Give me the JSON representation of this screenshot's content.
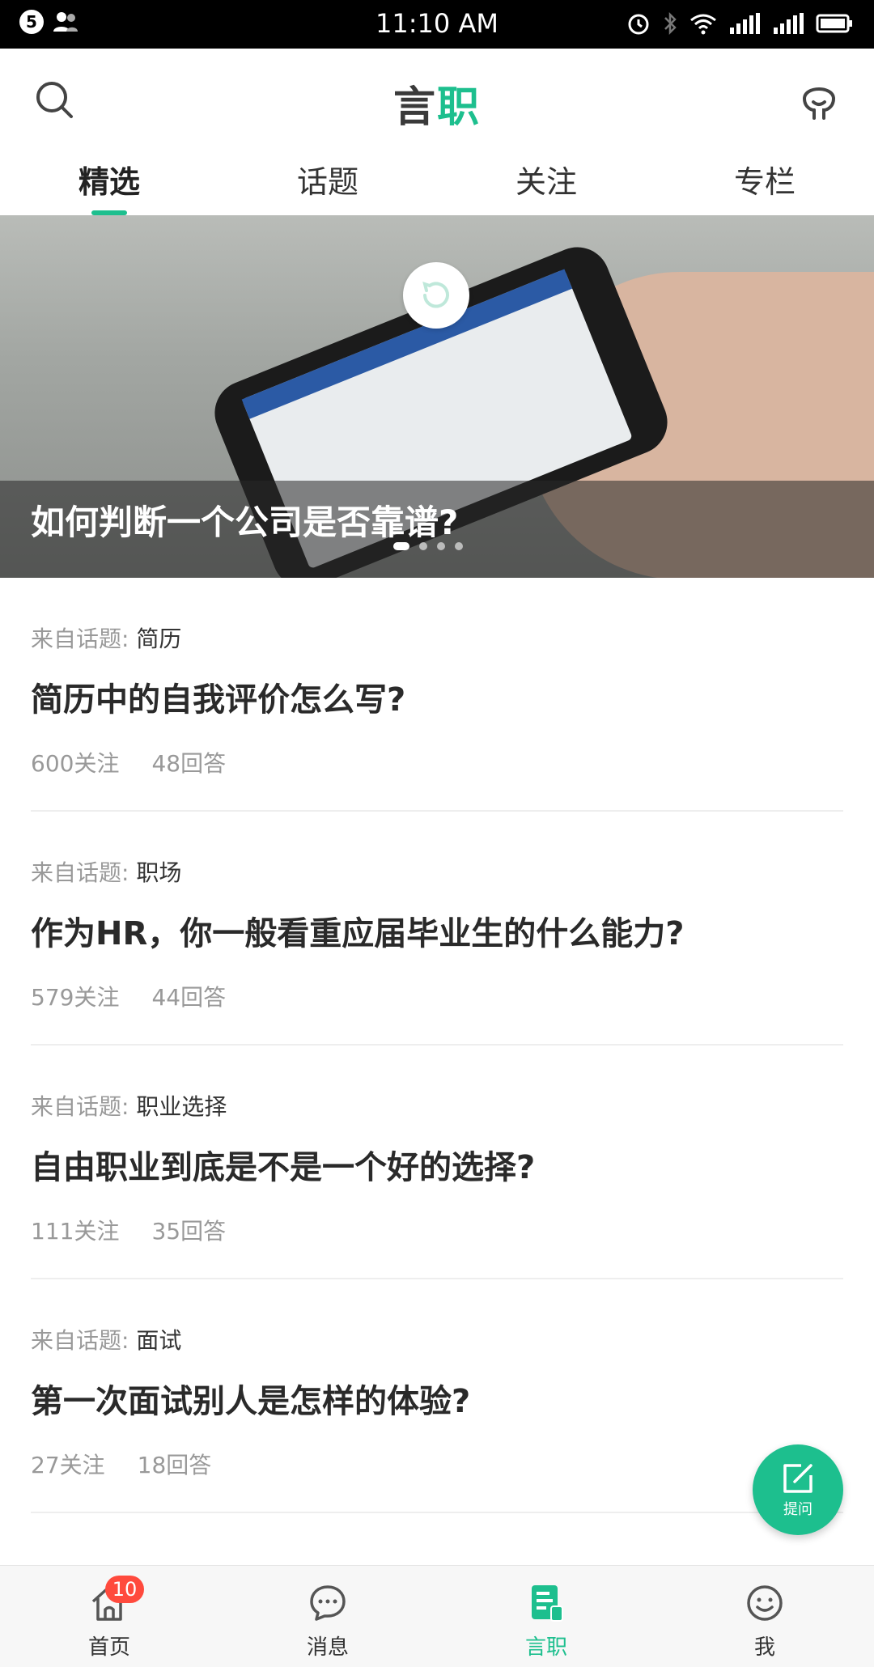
{
  "status_bar": {
    "notification_count": "5",
    "time": "11:10 AM"
  },
  "header": {
    "brand_part1": "言",
    "brand_part2": "职",
    "search_icon": "search-icon",
    "profile_icon": "robot-face-icon"
  },
  "tabs": [
    {
      "label": "精选",
      "active": true
    },
    {
      "label": "话题",
      "active": false
    },
    {
      "label": "关注",
      "active": false
    },
    {
      "label": "专栏",
      "active": false
    }
  ],
  "banner": {
    "title": "如何判断一个公司是否靠谱?",
    "page_count": 4,
    "active_page": 1
  },
  "feed": {
    "from_prefix": "来自话题:",
    "items": [
      {
        "topic": "简历",
        "question": "简历中的自我评价怎么写?",
        "follows": "600关注",
        "answers": "48回答"
      },
      {
        "topic": "职场",
        "question": "作为HR，你一般看重应届毕业生的什么能力?",
        "follows": "579关注",
        "answers": "44回答"
      },
      {
        "topic": "职业选择",
        "question": "自由职业到底是不是一个好的选择?",
        "follows": "111关注",
        "answers": "35回答"
      },
      {
        "topic": "面试",
        "question": "第一次面试别人是怎样的体验?",
        "follows": "27关注",
        "answers": "18回答"
      }
    ]
  },
  "fab": {
    "label": "提问",
    "icon": "edit-icon"
  },
  "bottom_nav": [
    {
      "label": "首页",
      "icon": "home-icon",
      "badge": "10",
      "active": false
    },
    {
      "label": "消息",
      "icon": "chat-bubble-icon",
      "active": false
    },
    {
      "label": "言职",
      "icon": "document-icon",
      "active": true
    },
    {
      "label": "我",
      "icon": "smiley-icon",
      "active": false
    }
  ],
  "colors": {
    "accent": "#1dbf8e",
    "badge": "#ff4a3d",
    "text_primary": "#2a2a2a",
    "text_secondary": "#999999"
  }
}
